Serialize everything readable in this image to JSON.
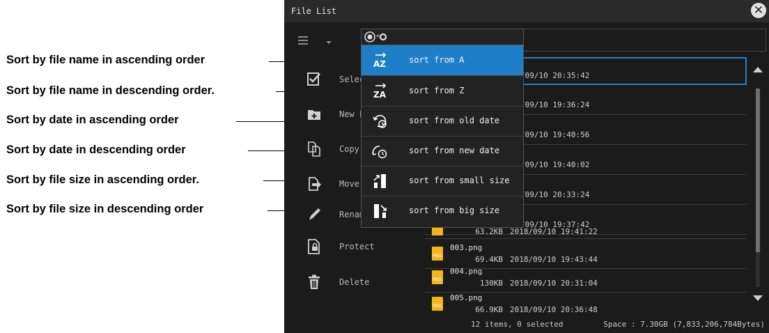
{
  "annotations": [
    "Sort by file name in ascending order",
    "Sort by file name in descending order.",
    "Sort by date in ascending order",
    "Sort by date in descending order",
    "Sort by file size in ascending order.",
    "Sort by file size in descending order"
  ],
  "window": {
    "title": "File List"
  },
  "actions": [
    {
      "label": "Selec",
      "icon": "checkbox-icon"
    },
    {
      "label": "New F",
      "icon": "new-folder-icon"
    },
    {
      "label": "Copy",
      "icon": "copy-icon"
    },
    {
      "label": "Move",
      "icon": "move-icon"
    },
    {
      "label": "Renam",
      "icon": "rename-pen-icon"
    },
    {
      "label": "Protect",
      "icon": "lock-file-icon"
    },
    {
      "label": "Delete",
      "icon": "trash-icon"
    }
  ],
  "sort_menu": {
    "header_icon": "target-sort-icon",
    "items": [
      {
        "label": "sort from A",
        "icon": "sort-az-icon",
        "active": true
      },
      {
        "label": "sort from Z",
        "icon": "sort-za-icon",
        "active": false
      },
      {
        "label": "sort from old date",
        "icon": "sort-old-date-icon",
        "active": false
      },
      {
        "label": "sort from new date",
        "icon": "sort-new-date-icon",
        "active": false
      },
      {
        "label": "sort from small size",
        "icon": "sort-small-size-icon",
        "active": false
      },
      {
        "label": "sort from big size",
        "icon": "sort-big-size-icon",
        "active": false
      }
    ]
  },
  "files_partial": [
    {
      "date": "/09/10 20:35:42"
    },
    {
      "date": "/09/10 19:36:24"
    },
    {
      "date": "/09/10 19:40:56"
    },
    {
      "date": "/09/10 19:40:02"
    },
    {
      "date": "/09/10 20:33:24"
    },
    {
      "date": "/09/10 19:37:42"
    }
  ],
  "files": [
    {
      "name": "",
      "size": "63.2KB",
      "date": "2018/09/10 19:41:22"
    },
    {
      "name": "003.png",
      "size": "69.4KB",
      "date": "2018/09/10 19:43:44"
    },
    {
      "name": "004.png",
      "size": "130KB",
      "date": "2018/09/10 20:31:04"
    },
    {
      "name": "005.png",
      "size": "66.9KB",
      "date": "2018/09/10 20:36:48"
    }
  ],
  "file_icon_text": "PNG",
  "status": {
    "count": "12 items, 0 selected",
    "space": "Space : 7.30GB (7,833,206,784Bytes)"
  },
  "colors": {
    "accent": "#1e7fc8",
    "background": "#1b1b1b",
    "file_icon": "#f2b51f"
  }
}
